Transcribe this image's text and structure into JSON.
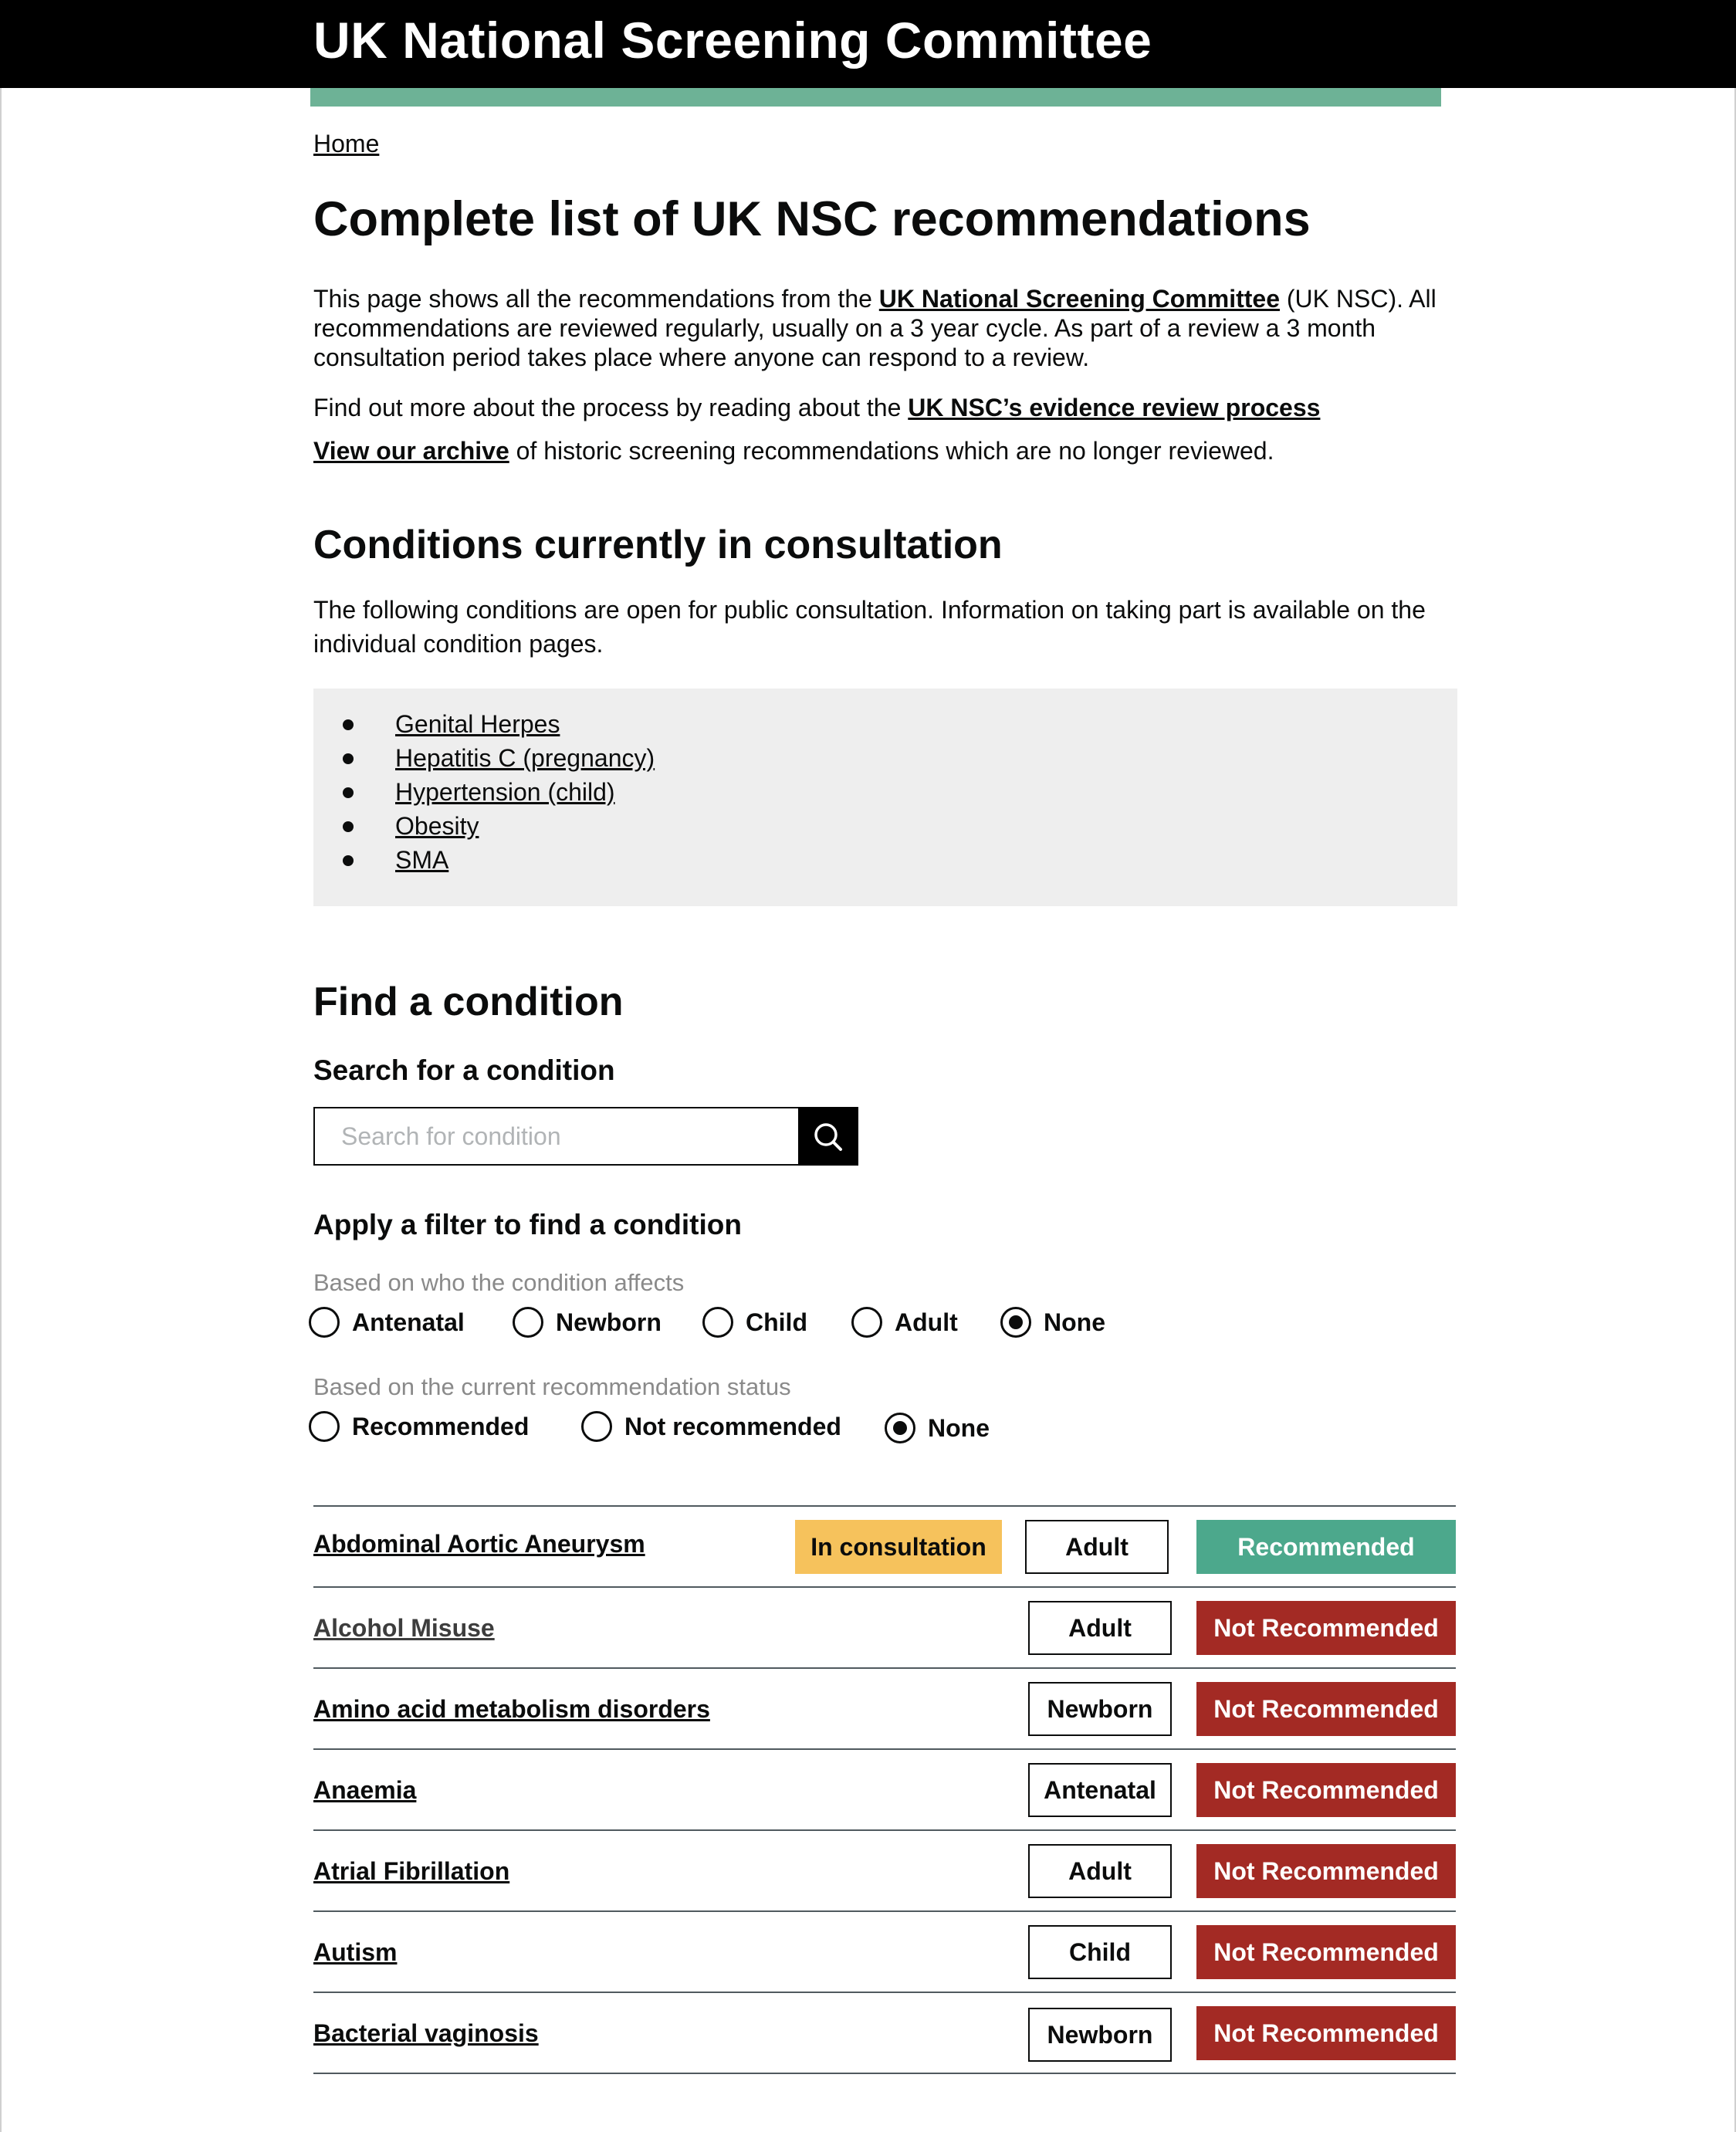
{
  "header": {
    "title": "UK National Screening Committee",
    "accent_color": "#6db296"
  },
  "breadcrumb": {
    "home": "Home"
  },
  "page_title": "Complete list of UK NSC recommendations",
  "intro": {
    "text_before_link": "This page shows all the recommendations from the ",
    "link_committee": "UK National Screening Committee",
    "text_after_link": " (UK NSC). All recommendations are reviewed regularly, usually on a 3 year cycle. As part of a review a 3 month consultation period takes place where anyone can respond to a review.",
    "process_text": "Find out more about the process by reading about the ",
    "process_link": "UK NSC’s evidence review process",
    "archive_link": "View our archive",
    "archive_text": " of historic screening recommendations which are no longer reviewed."
  },
  "consultation": {
    "heading": "Conditions currently in consultation",
    "description": "The following conditions are open for public consultation. Information on taking part is available on the individual condition pages.",
    "items": [
      "Genital Herpes",
      "Hepatitis C (pregnancy)",
      "Hypertension (child)",
      "Obesity",
      "SMA"
    ]
  },
  "find": {
    "heading": "Find a condition",
    "search_label": "Search for a condition",
    "search_placeholder": "Search for condition",
    "search_icon": "magnifier-icon",
    "filter_heading": "Apply a filter to find a condition",
    "who_caption": "Based on who the condition affects",
    "who_options": [
      "Antenatal",
      "Newborn",
      "Child",
      "Adult",
      "None"
    ],
    "who_selected": "None",
    "status_caption": "Based on the current recommendation status",
    "status_options": [
      "Recommended",
      "Not recommended",
      "None"
    ],
    "status_selected": "None"
  },
  "colors": {
    "recommended": "#4ca88c",
    "not_recommended": "#a32a24",
    "in_consultation": "#f6c25c"
  },
  "results": [
    {
      "name": "Abdominal Aortic Aneurysm",
      "consultation": "In consultation",
      "who": "Adult",
      "status": "Recommended"
    },
    {
      "name": "Alcohol Misuse",
      "consultation": "",
      "who": "Adult",
      "status": "Not Recommended"
    },
    {
      "name": "Amino acid metabolism disorders",
      "consultation": "",
      "who": "Newborn",
      "status": "Not Recommended"
    },
    {
      "name": "Anaemia",
      "consultation": "",
      "who": "Antenatal",
      "status": "Not Recommended"
    },
    {
      "name": "Atrial Fibrillation",
      "consultation": "",
      "who": "Adult",
      "status": "Not Recommended"
    },
    {
      "name": "Autism",
      "consultation": "",
      "who": "Child",
      "status": "Not Recommended"
    },
    {
      "name": "Bacterial vaginosis",
      "consultation": "",
      "who": "Newborn",
      "status": "Not Recommended"
    }
  ]
}
